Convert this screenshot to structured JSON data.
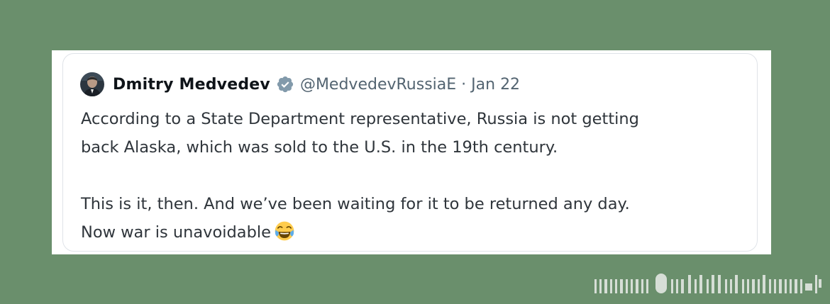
{
  "tweet": {
    "author_name": "Dmitry Medvedev",
    "handle": "@MedvedevRussiaE",
    "separator": "·",
    "date": "Jan 22",
    "paragraph_1_line_1": "According to a State Department representative, Russia is not getting",
    "paragraph_1_line_2": "back Alaska, which was sold to the U.S. in the 19th century.",
    "paragraph_2_line_1": "This is it, then. And we’ve been waiting for it to be returned any day.",
    "paragraph_2_line_2": "Now war is unavoidable",
    "icons": {
      "avatar": "profile-photo",
      "verified": "verified-badge-icon",
      "emoji": "tears-of-joy-emoji"
    }
  },
  "colors": {
    "background": "#6a8f6c",
    "card": "#ffffff",
    "card_border": "#dfe3e8",
    "name": "#0f1419",
    "secondary_text": "#536471",
    "body_text": "#2f353b",
    "verified_badge": "#829aab"
  }
}
